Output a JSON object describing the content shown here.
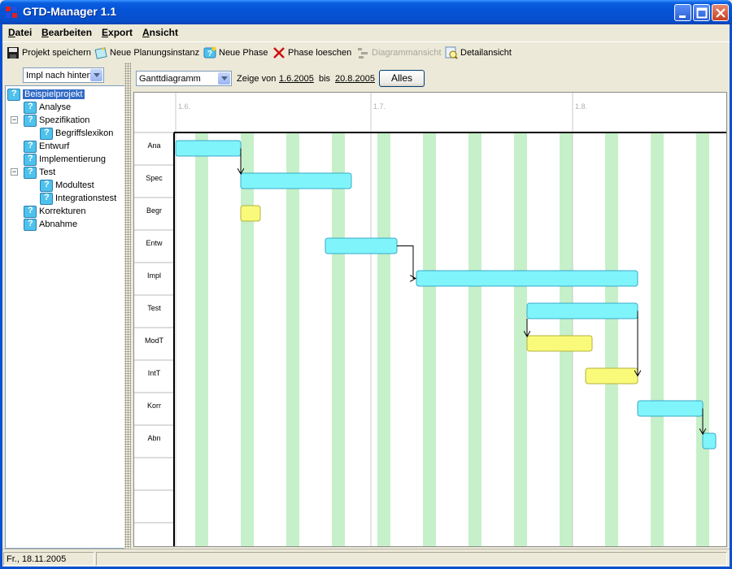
{
  "window": {
    "title": "GTD-Manager 1.1"
  },
  "menu": {
    "items": [
      "Datei",
      "Bearbeiten",
      "Export",
      "Ansicht"
    ]
  },
  "toolbar": {
    "save": "Projekt speichern",
    "new_planning": "Neue Planungsinstanz",
    "new_phase": "Neue Phase",
    "delete_phase": "Phase loeschen",
    "diagram_view": "Diagrammansicht",
    "detail_view": "Detailansicht"
  },
  "left": {
    "combo_value": "Impl nach hinten",
    "tree": [
      {
        "label": "Beispielprojekt",
        "level": 0,
        "selected": true,
        "expandable": false
      },
      {
        "label": "Analyse",
        "level": 1
      },
      {
        "label": "Spezifikation",
        "level": 1,
        "expandable": true
      },
      {
        "label": "Begriffslexikon",
        "level": 2
      },
      {
        "label": "Entwurf",
        "level": 1
      },
      {
        "label": "Implementierung",
        "level": 1
      },
      {
        "label": "Test",
        "level": 1,
        "expandable": true
      },
      {
        "label": "Modultest",
        "level": 2
      },
      {
        "label": "Integrationstest",
        "level": 2
      },
      {
        "label": "Korrekturen",
        "level": 1
      },
      {
        "label": "Abnahme",
        "level": 1
      }
    ]
  },
  "view": {
    "type_value": "Ganttdiagramm",
    "show_from_label": "Zeige von",
    "from_date": "1.6.2005",
    "to_label": "bis",
    "to_date": "20.8.2005",
    "all_button": "Alles"
  },
  "gantt": {
    "start_date": "2005-06-01",
    "end_date": "2005-08-20",
    "month_labels": [
      {
        "label": "1.6.",
        "day": 0
      },
      {
        "label": "1.7.",
        "day": 30
      },
      {
        "label": "1.8.",
        "day": 61
      }
    ],
    "weekend_stripes_start_day": 3,
    "rows": [
      {
        "label": "Ana",
        "start": 0,
        "end": 10,
        "color": "cyan"
      },
      {
        "label": "Spec",
        "start": 10,
        "end": 27,
        "color": "cyan"
      },
      {
        "label": "Begr",
        "start": 10,
        "end": 13,
        "color": "yellow"
      },
      {
        "label": "Entw",
        "start": 23,
        "end": 34,
        "color": "cyan"
      },
      {
        "label": "Impl",
        "start": 37,
        "end": 71,
        "color": "cyan"
      },
      {
        "label": "Test",
        "start": 54,
        "end": 71,
        "color": "cyan"
      },
      {
        "label": "ModT",
        "start": 54,
        "end": 64,
        "color": "yellow"
      },
      {
        "label": "IntT",
        "start": 63,
        "end": 71,
        "color": "yellow"
      },
      {
        "label": "Korr",
        "start": 71,
        "end": 81,
        "color": "cyan"
      },
      {
        "label": "Abn",
        "start": 81,
        "end": 83,
        "color": "cyan"
      },
      {
        "label": "",
        "start": null,
        "end": null
      },
      {
        "label": "",
        "start": null,
        "end": null
      },
      {
        "label": "",
        "start": null,
        "end": null
      }
    ],
    "dependencies": [
      {
        "from": 0,
        "to": 1
      },
      {
        "from": 3,
        "to": 4
      },
      {
        "from": 5,
        "to": 6
      },
      {
        "from": 5,
        "to": 7
      },
      {
        "from": 8,
        "to": 9
      }
    ],
    "colors": {
      "cyan": "#7ff5fb",
      "cyan_border": "#3aa9c9",
      "yellow": "#fafa7a",
      "yellow_border": "#b3b342",
      "weekend": "#c6f0c9"
    }
  },
  "status": {
    "date": "Fr., 18.11.2005"
  }
}
